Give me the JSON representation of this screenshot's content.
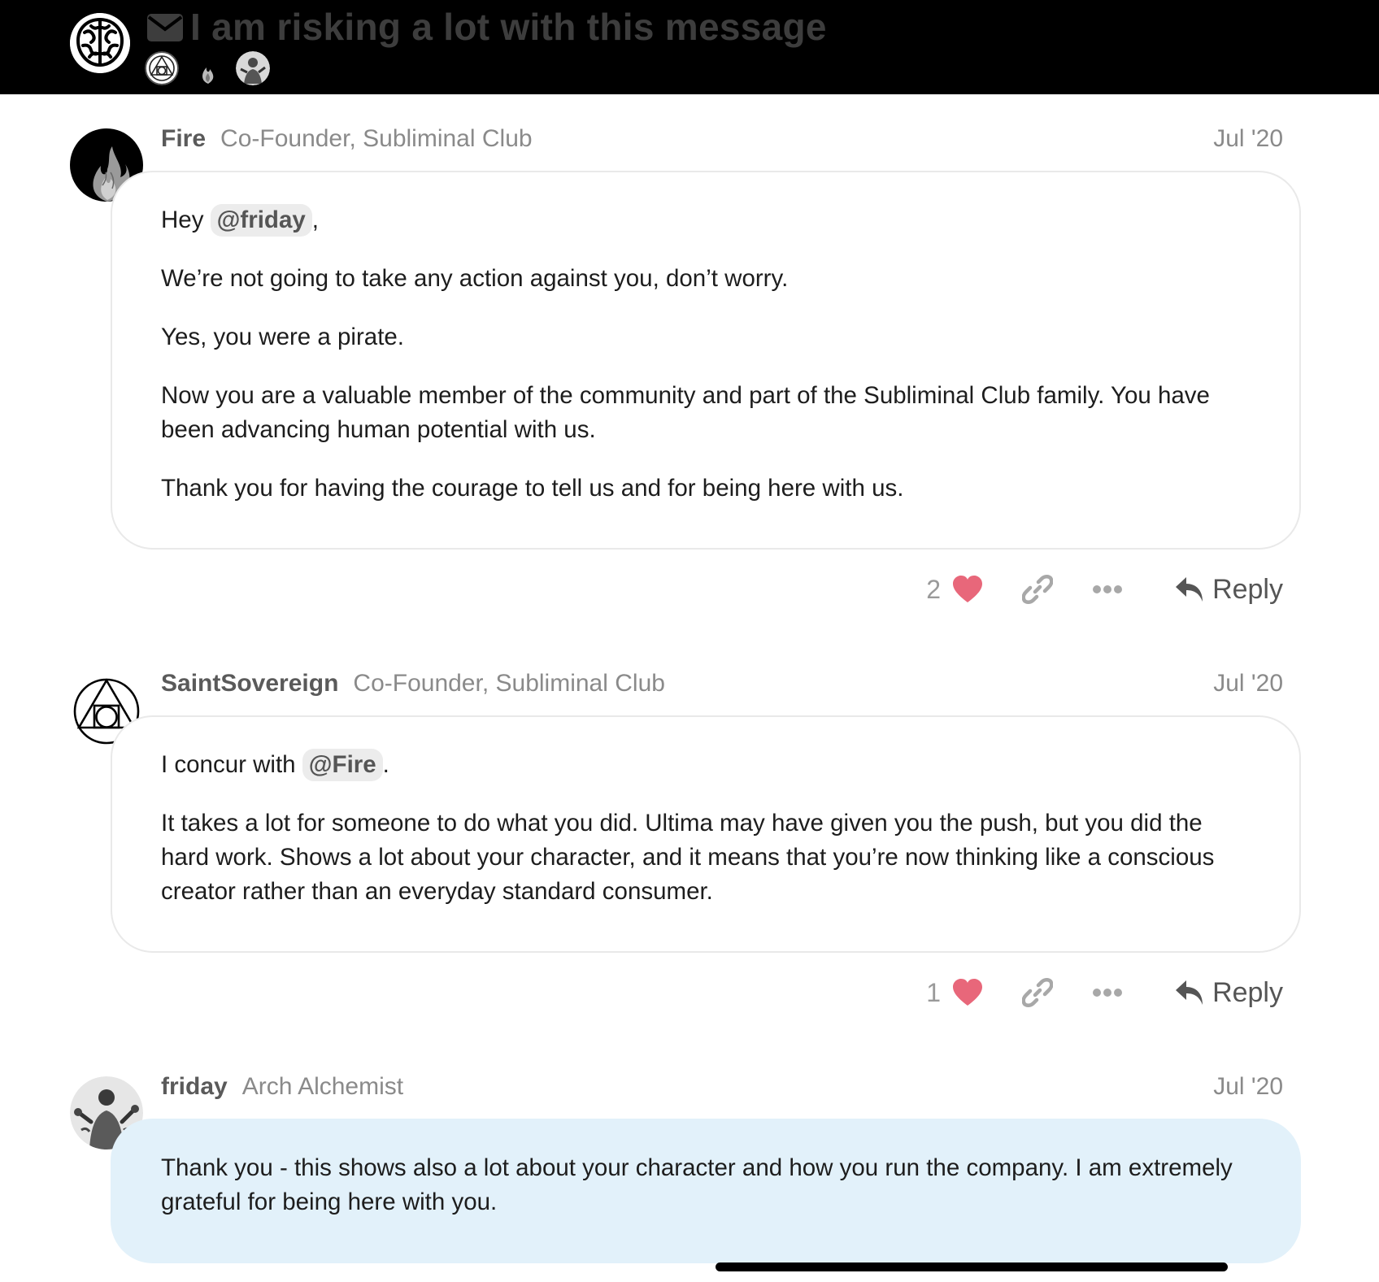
{
  "header": {
    "title": "I am risking a lot with this message",
    "logo_icon": "brain-icon",
    "message_icon": "envelope-icon"
  },
  "posts": [
    {
      "username": "Fire",
      "user_title": "Co-Founder, Subliminal Club",
      "date": "Jul '20",
      "greeting_prefix": "Hey",
      "greeting_mention": "@friday",
      "greeting_suffix": ",",
      "paragraphs": [
        "We’re not going to take any action against you, don’t worry.",
        "Yes, you were a pirate.",
        "Now you are a valuable member of the community and part of the Subliminal Club family. You have been advancing human potential with us.",
        "Thank you for having the courage to tell us and for being here with us."
      ],
      "likes": "2",
      "reply_label": "Reply"
    },
    {
      "username": "SaintSovereign",
      "user_title": "Co-Founder, Subliminal Club",
      "date": "Jul '20",
      "greeting_prefix": "I concur with",
      "greeting_mention": "@Fire",
      "greeting_suffix": ".",
      "paragraphs": [
        "It takes a lot for someone to do what you did. Ultima may have given you the push, but you did the hard work. Shows a lot about your character, and it means that you’re now thinking like a conscious creator rather than an everyday standard consumer."
      ],
      "likes": "1",
      "reply_label": "Reply"
    },
    {
      "username": "friday",
      "user_title": "Arch Alchemist",
      "date": "Jul '20",
      "paragraphs": [
        "Thank you - this shows also a lot about your character and how you run the company. I am extremely grateful for being here with you."
      ]
    }
  ],
  "colors": {
    "header_bg": "#000000",
    "heart": "#e8677a",
    "own_post_bg": "#e2f1fa",
    "mention_bg": "#ececec"
  }
}
